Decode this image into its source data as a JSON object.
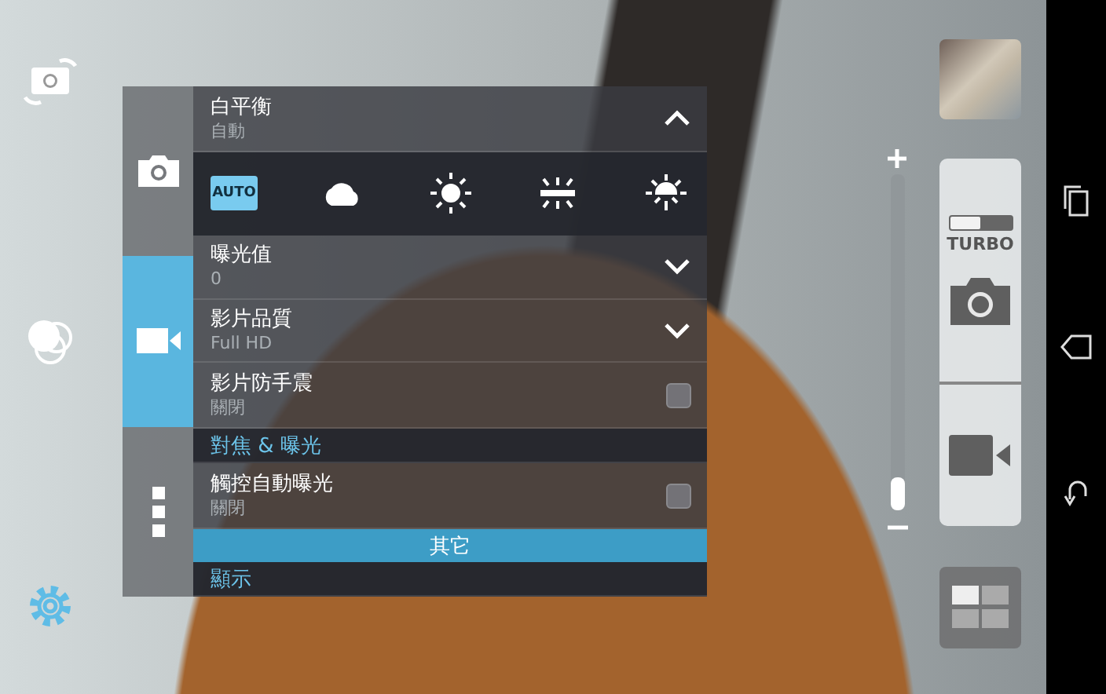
{
  "panel": {
    "tabs": [
      {
        "kind": "camera",
        "selected": false
      },
      {
        "kind": "video",
        "selected": true
      },
      {
        "kind": "more",
        "selected": false
      }
    ],
    "items": [
      {
        "kind": "dropdown",
        "title": "白平衡",
        "value": "自動",
        "expanded": true
      },
      {
        "kind": "options",
        "options": [
          {
            "kind": "auto",
            "label": "AUTO",
            "selected": true
          },
          {
            "kind": "cloudy",
            "selected": false
          },
          {
            "kind": "daylight",
            "selected": false
          },
          {
            "kind": "fluorescent",
            "selected": false
          },
          {
            "kind": "incandescent",
            "selected": false
          }
        ]
      },
      {
        "kind": "dropdown",
        "title": "曝光值",
        "value": "0",
        "expanded": false
      },
      {
        "kind": "dropdown",
        "title": "影片品質",
        "value": "Full HD",
        "expanded": false
      },
      {
        "kind": "checkbox",
        "title": "影片防手震",
        "value": "關閉",
        "checked": false
      },
      {
        "kind": "section",
        "title": "對焦 & 曝光"
      },
      {
        "kind": "checkbox",
        "title": "觸控自動曝光",
        "value": "關閉",
        "checked": false
      },
      {
        "kind": "group_bar",
        "title": "其它"
      },
      {
        "kind": "section",
        "title": "顯示"
      }
    ]
  },
  "zoom": {
    "level": 0.1
  },
  "turbo": {
    "label": "TURBO",
    "on": false
  }
}
